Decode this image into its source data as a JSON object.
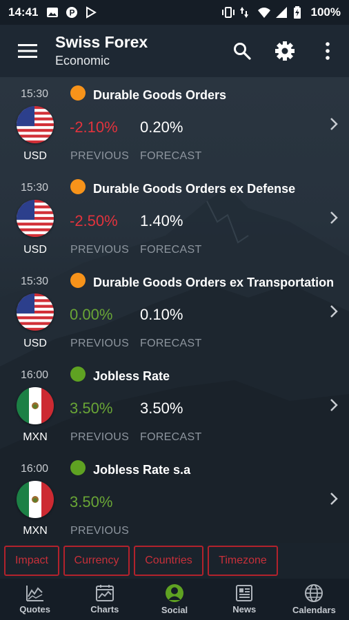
{
  "status_bar": {
    "time": "14:41",
    "battery": "100%",
    "left_icons": [
      "image-icon",
      "p-icon",
      "play-store-icon"
    ],
    "right_icons": [
      "vibrate-icon",
      "data-arrows-icon",
      "wifi-icon",
      "signal-icon",
      "battery-icon"
    ]
  },
  "app_bar": {
    "title": "Swiss Forex",
    "subtitle": "Economic",
    "actions": [
      "search-icon",
      "gear-icon",
      "more-vert-icon"
    ]
  },
  "colors": {
    "negative": "#e2333d",
    "positive": "#6aa636",
    "impact_medium": "#f7931a",
    "impact_low": "#5fa222",
    "chip_red": "#c8303a"
  },
  "events": [
    {
      "time": "15:30",
      "currency": "USD",
      "flag": "us-flag-icon",
      "impact": "orange",
      "name": "Durable Goods Orders",
      "previous": "-2.10%",
      "previous_trend": "negative",
      "forecast": "0.20%",
      "previous_label": "PREVIOUS",
      "forecast_label": "FORECAST"
    },
    {
      "time": "15:30",
      "currency": "USD",
      "flag": "us-flag-icon",
      "impact": "orange",
      "name": "Durable Goods Orders ex Defense",
      "previous": "-2.50%",
      "previous_trend": "negative",
      "forecast": "1.40%",
      "previous_label": "PREVIOUS",
      "forecast_label": "FORECAST"
    },
    {
      "time": "15:30",
      "currency": "USD",
      "flag": "us-flag-icon",
      "impact": "orange",
      "name": "Durable Goods Orders ex Transportation",
      "previous": "0.00%",
      "previous_trend": "positive",
      "forecast": "0.10%",
      "previous_label": "PREVIOUS",
      "forecast_label": "FORECAST"
    },
    {
      "time": "16:00",
      "currency": "MXN",
      "flag": "mexico-flag-icon",
      "impact": "green",
      "name": "Jobless Rate",
      "previous": "3.50%",
      "previous_trend": "positive",
      "forecast": "3.50%",
      "previous_label": "PREVIOUS",
      "forecast_label": "FORECAST"
    },
    {
      "time": "16:00",
      "currency": "MXN",
      "flag": "mexico-flag-icon",
      "impact": "green",
      "name": "Jobless Rate s.a",
      "previous": "3.50%",
      "previous_trend": "positive",
      "forecast": "",
      "previous_label": "PREVIOUS",
      "forecast_label": ""
    }
  ],
  "filters": [
    "Impact",
    "Currency",
    "Countries",
    "Timezone"
  ],
  "bottom_nav": [
    {
      "label": "Quotes",
      "icon": "quotes-chart-icon",
      "active": false
    },
    {
      "label": "Charts",
      "icon": "charts-icon",
      "active": false
    },
    {
      "label": "Social",
      "icon": "social-person-icon",
      "active": true
    },
    {
      "label": "News",
      "icon": "news-icon",
      "active": false
    },
    {
      "label": "Calendars",
      "icon": "calendar-globe-icon",
      "active": false
    }
  ]
}
